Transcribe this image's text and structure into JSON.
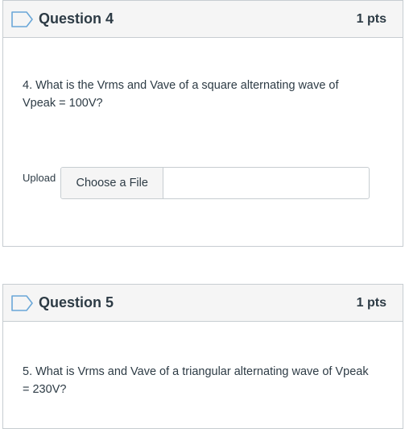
{
  "questions": [
    {
      "title": "Question 4",
      "points": "1 pts",
      "text": "4. What is the Vrms and Vave of a square alternating wave of Vpeak = 100V?",
      "upload": {
        "label": "Upload",
        "button_label": "Choose a File"
      }
    },
    {
      "title": "Question 5",
      "points": "1 pts",
      "text": "5. What is Vrms and Vave of a triangular alternating wave of Vpeak = 230V?"
    }
  ],
  "icons": {
    "flag": "bookmark-flag-icon"
  },
  "colors": {
    "icon_outline": "#6aa7d8",
    "header_bg": "#f5f5f5",
    "border": "#c7cdd1",
    "text": "#2d3b45"
  }
}
